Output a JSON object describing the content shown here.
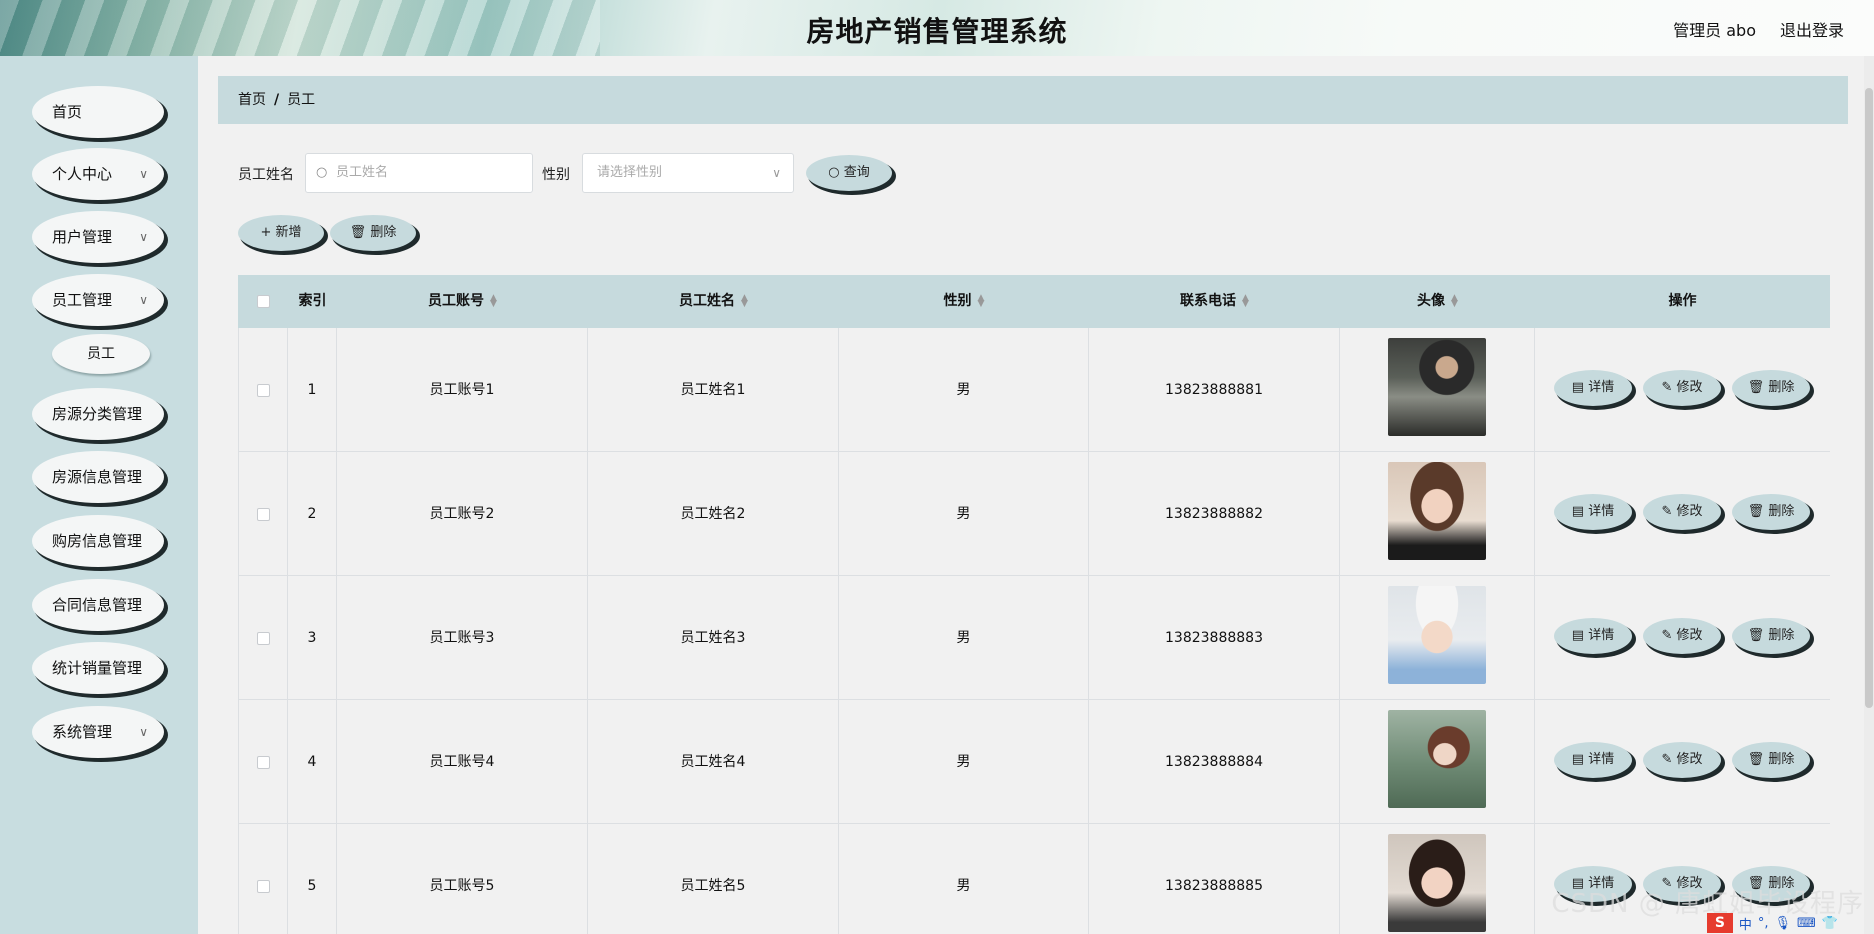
{
  "header": {
    "title": "房地产销售管理系统",
    "user_label": "管理员 abo",
    "logout_label": "退出登录"
  },
  "sidebar": {
    "items": [
      {
        "label": "首页",
        "has_children": false
      },
      {
        "label": "个人中心",
        "has_children": true
      },
      {
        "label": "用户管理",
        "has_children": true
      },
      {
        "label": "员工管理",
        "has_children": true
      },
      {
        "label": "房源分类管理",
        "has_children": false
      },
      {
        "label": "房源信息管理",
        "has_children": false
      },
      {
        "label": "购房信息管理",
        "has_children": false
      },
      {
        "label": "合同信息管理",
        "has_children": false
      },
      {
        "label": "统计销量管理",
        "has_children": false
      },
      {
        "label": "系统管理",
        "has_children": true
      }
    ],
    "subitems": [
      {
        "label": "员工"
      }
    ]
  },
  "breadcrumb": {
    "home": "首页",
    "separator": "/",
    "current": "员工"
  },
  "search": {
    "name_label": "员工姓名",
    "name_placeholder": "员工姓名",
    "gender_label": "性别",
    "gender_placeholder": "请选择性别",
    "query_label": "查询"
  },
  "toolbar": {
    "add_label": "新增",
    "delete_label": "删除"
  },
  "table": {
    "columns": {
      "index": "索引",
      "account": "员工账号",
      "name": "员工姓名",
      "gender": "性别",
      "phone": "联系电话",
      "avatar": "头像",
      "actions": "操作"
    },
    "rows": [
      {
        "index": "1",
        "account": "员工账号1",
        "name": "员工姓名1",
        "gender": "男",
        "phone": "13823888881",
        "avatar": "man-at-table"
      },
      {
        "index": "2",
        "account": "员工账号2",
        "name": "员工姓名2",
        "gender": "男",
        "phone": "13823888882",
        "avatar": "woman-portrait"
      },
      {
        "index": "3",
        "account": "员工账号3",
        "name": "员工姓名3",
        "gender": "男",
        "phone": "13823888883",
        "avatar": "woman-with-cap"
      },
      {
        "index": "4",
        "account": "员工账号4",
        "name": "员工姓名4",
        "gender": "男",
        "phone": "13823888884",
        "avatar": "woman-ponytail"
      },
      {
        "index": "5",
        "account": "员工账号5",
        "name": "员工姓名5",
        "gender": "男",
        "phone": "13823888885",
        "avatar": "woman-smiling"
      }
    ],
    "row_actions": {
      "detail": "详情",
      "edit": "修改",
      "delete": "删除"
    }
  },
  "watermark": "CSDN @ 唐虹姐毕设程序",
  "ime": {
    "badge": "S",
    "mode": "中"
  },
  "colors": {
    "sidebar_bg": "#c8dde0",
    "accent": "#c6dadd",
    "main_bg": "#f1f1f1",
    "shadow": "#1f2a2c"
  }
}
